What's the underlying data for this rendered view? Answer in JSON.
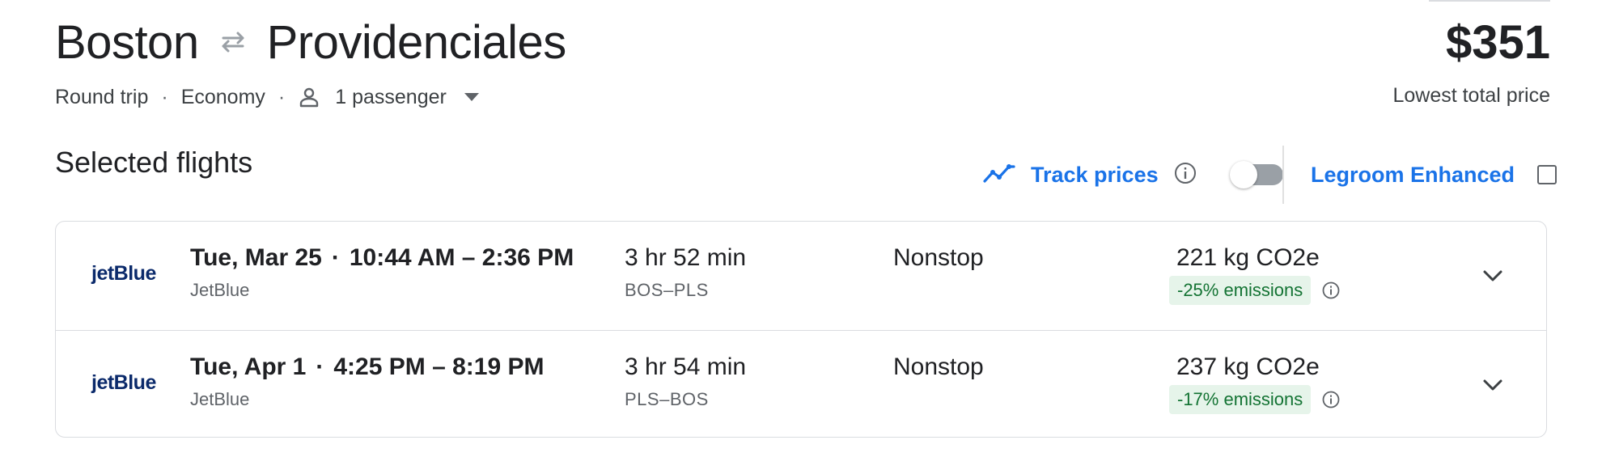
{
  "route": {
    "origin": "Boston",
    "destination": "Providenciales"
  },
  "price": {
    "amount": "$351",
    "label": "Lowest total price"
  },
  "trip": {
    "type": "Round trip",
    "cabin": "Economy",
    "passengers": "1 passenger"
  },
  "section_title": "Selected flights",
  "track_prices": {
    "label": "Track prices",
    "enabled": false
  },
  "legroom": {
    "label": "Legroom Enhanced",
    "checked": false
  },
  "colors": {
    "accent": "#1a73e8",
    "emissions_bg": "#e6f4ea",
    "emissions_text": "#137333"
  },
  "flights": [
    {
      "logo_text": "jetBlue",
      "date": "Tue, Mar 25",
      "times": "10:44 AM – 2:36 PM",
      "airline": "JetBlue",
      "duration": "3 hr 52 min",
      "airports": "BOS–PLS",
      "stops": "Nonstop",
      "emissions": "221 kg CO2e",
      "emissions_change": "-25% emissions"
    },
    {
      "logo_text": "jetBlue",
      "date": "Tue, Apr 1",
      "times": "4:25 PM – 8:19 PM",
      "airline": "JetBlue",
      "duration": "3 hr 54 min",
      "airports": "PLS–BOS",
      "stops": "Nonstop",
      "emissions": "237 kg CO2e",
      "emissions_change": "-17% emissions"
    }
  ],
  "icons": {
    "swap": "swap-arrows-icon",
    "person": "person-icon",
    "dropdown": "dropdown-caret-icon",
    "track": "trend-line-icon",
    "info": "info-icon",
    "expand": "chevron-down-icon"
  }
}
